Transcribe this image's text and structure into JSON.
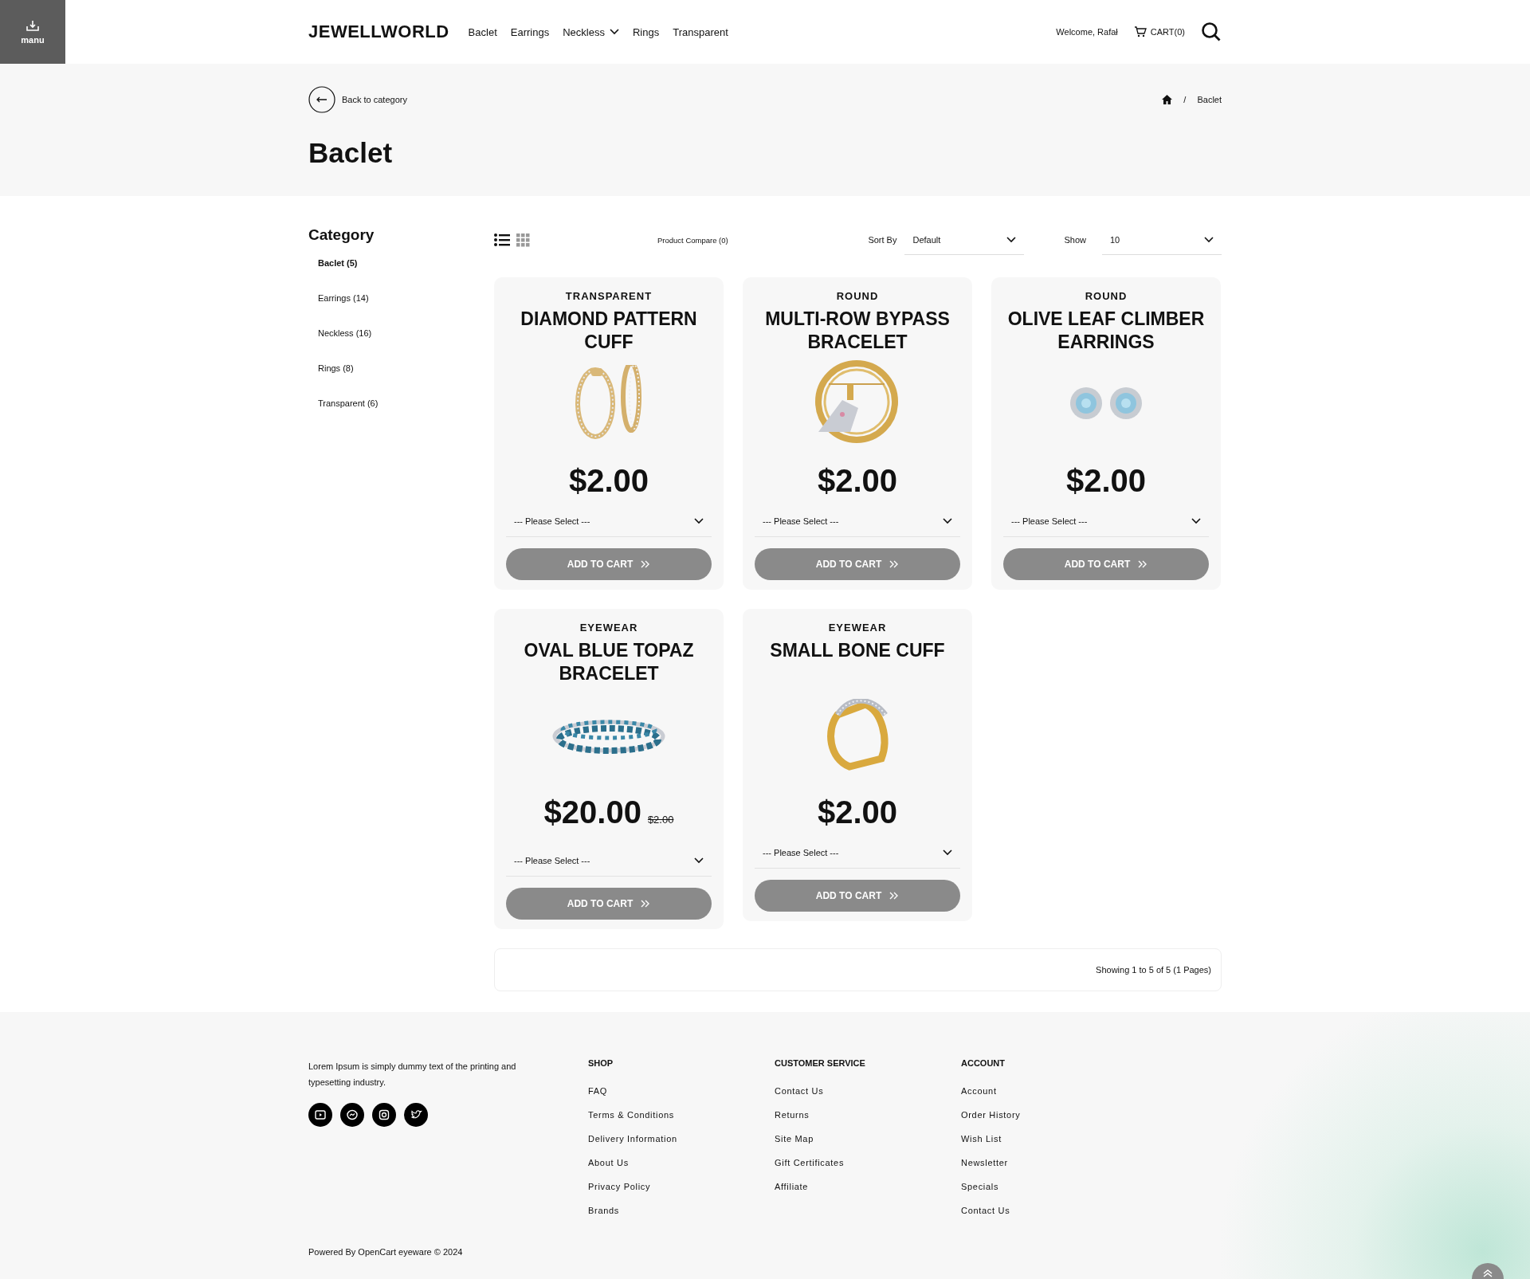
{
  "menu_tile": {
    "label": "manu"
  },
  "header": {
    "logo": "JEWELLWORLD",
    "nav": [
      {
        "label": "Baclet",
        "dropdown": false
      },
      {
        "label": "Earrings",
        "dropdown": false
      },
      {
        "label": "Neckless",
        "dropdown": true
      },
      {
        "label": "Rings",
        "dropdown": false
      },
      {
        "label": "Transparent",
        "dropdown": false
      }
    ],
    "welcome": "Welcome, Rafał",
    "cart": "CART(0)"
  },
  "hero": {
    "back": "Back to category",
    "separator": "/",
    "breadcrumb": [
      "Baclet"
    ],
    "title": "Baclet"
  },
  "sidebar": {
    "title": "Category",
    "items": [
      {
        "label": "Baclet (5)",
        "selected": true
      },
      {
        "label": "Earrings (14)",
        "selected": false
      },
      {
        "label": "Neckless (16)",
        "selected": false
      },
      {
        "label": "Rings (8)",
        "selected": false
      },
      {
        "label": "Transparent (6)",
        "selected": false
      }
    ]
  },
  "toolbar": {
    "views": [
      {
        "selected": true
      },
      {
        "selected": false
      }
    ],
    "compare": "Product Compare (0)",
    "sort_label": "Sort By",
    "sort_value": "Default",
    "show_label": "Show",
    "show_value": "10"
  },
  "products": [
    {
      "category": "TRANSPARENT",
      "name": "DIAMOND PATTERN CUFF",
      "price": "$2.00",
      "option": "--- Please Select ---",
      "button": "ADD TO CART"
    },
    {
      "category": "ROUND",
      "name": "MULTI-ROW BYPASS BRACELET",
      "price": "$2.00",
      "option": "--- Please Select ---",
      "button": "ADD TO CART"
    },
    {
      "category": "ROUND",
      "name": "OLIVE LEAF CLIMBER EARRINGS",
      "price": "$2.00",
      "option": "--- Please Select ---",
      "button": "ADD TO CART"
    },
    {
      "category": "EYEWEAR",
      "name": "OVAL BLUE TOPAZ BRACELET",
      "price": "$20.00",
      "old_price": "$2.00",
      "option": "--- Please Select ---",
      "button": "ADD TO CART"
    },
    {
      "category": "EYEWEAR",
      "name": "SMALL BONE CUFF",
      "price": "$2.00",
      "option": "--- Please Select ---",
      "button": "ADD TO CART"
    }
  ],
  "pagination": {
    "summary": "Showing 1 to 5 of 5 (1 Pages)"
  },
  "footer": {
    "about": "Lorem Ipsum is simply dummy text of the printing and typesetting industry.",
    "columns": [
      {
        "title": "SHOP",
        "links": [
          "FAQ",
          "Terms & Conditions",
          "Delivery Information",
          "About Us",
          "Privacy Policy",
          "Brands"
        ]
      },
      {
        "title": "CUSTOMER SERVICE",
        "links": [
          "Contact Us",
          "Returns",
          "Site Map",
          "Gift Certificates",
          "Affiliate"
        ]
      },
      {
        "title": "ACCOUNT",
        "links": [
          "Account",
          "Order History",
          "Wish List",
          "Newsletter",
          "Specials",
          "Contact Us"
        ]
      }
    ],
    "copyright": "Powered By OpenCart eyeware © 2024"
  }
}
